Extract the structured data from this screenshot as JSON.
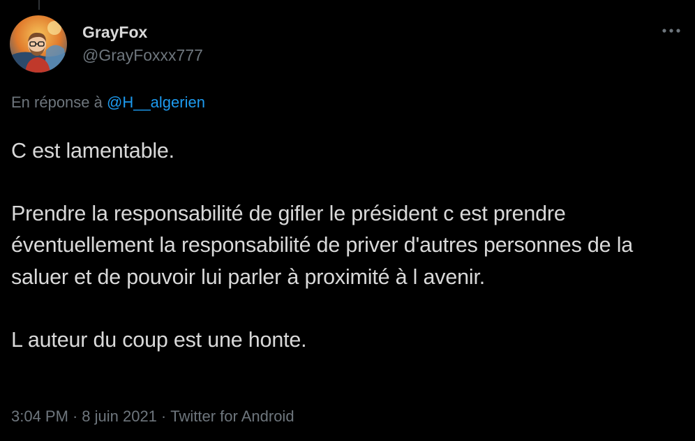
{
  "author": {
    "display_name": "GrayFox",
    "handle": "@GrayFoxxx777",
    "avatar": "avatar-cartoon-man-with-glasses"
  },
  "reply": {
    "prefix": "En réponse à ",
    "mention": "@H__algerien"
  },
  "tweet": {
    "paragraphs": [
      "C est lamentable.",
      "Prendre la responsabilité de gifler le président c est prendre éventuellement la responsabilité de priver d'autres personnes de la saluer et de pouvoir lui parler à proximité à l avenir.",
      "L auteur du coup est une honte."
    ]
  },
  "meta": {
    "time": "3:04 PM",
    "separator": "·",
    "date": "8 juin 2021",
    "source": "Twitter for Android"
  },
  "icons": {
    "more": "more-horizontal-icon"
  },
  "colors": {
    "background": "#000000",
    "text": "#d9d9d9",
    "secondary": "#6e767d",
    "link": "#1d9bf0"
  }
}
